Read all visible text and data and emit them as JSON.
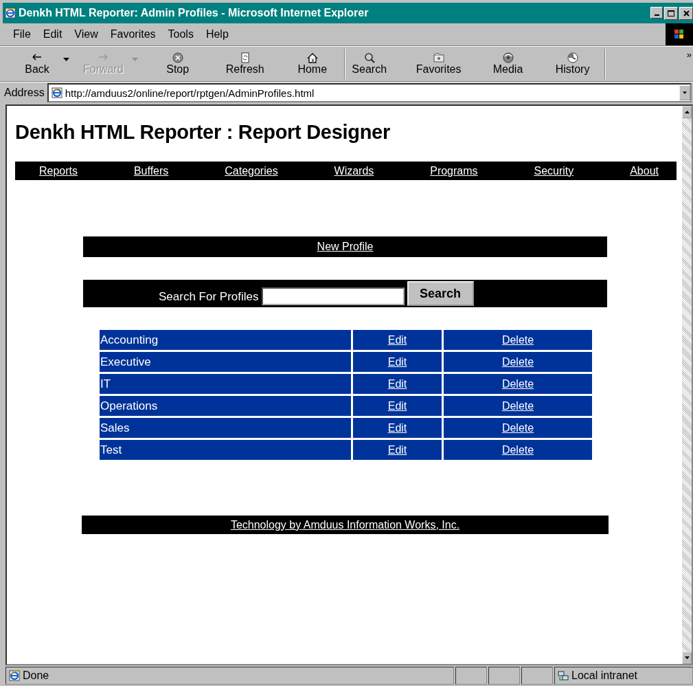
{
  "window": {
    "title": "Denkh HTML Reporter: Admin Profiles - Microsoft Internet Explorer"
  },
  "menu": [
    "File",
    "Edit",
    "View",
    "Favorites",
    "Tools",
    "Help"
  ],
  "toolbar": [
    {
      "kind": "back",
      "label": "Back",
      "disabled": false,
      "dropdown": true,
      "separator_after": false
    },
    {
      "kind": "forward",
      "label": "Forward",
      "disabled": true,
      "dropdown": true,
      "separator_after": false
    },
    {
      "kind": "stop",
      "label": "Stop",
      "disabled": false,
      "dropdown": false,
      "separator_after": false
    },
    {
      "kind": "refresh",
      "label": "Refresh",
      "disabled": false,
      "dropdown": false,
      "separator_after": false
    },
    {
      "kind": "home",
      "label": "Home",
      "disabled": false,
      "dropdown": false,
      "separator_after": true
    },
    {
      "kind": "search",
      "label": "Search",
      "disabled": false,
      "dropdown": false,
      "separator_after": false
    },
    {
      "kind": "favorites",
      "label": "Favorites",
      "disabled": false,
      "dropdown": false,
      "separator_after": false
    },
    {
      "kind": "media",
      "label": "Media",
      "disabled": false,
      "dropdown": false,
      "separator_after": false
    },
    {
      "kind": "history",
      "label": "History",
      "disabled": false,
      "dropdown": false,
      "separator_after": true
    }
  ],
  "toolbar_more": "»",
  "address": {
    "label": "Address",
    "url": "http://amduus2/online/report/rptgen/AdminProfiles.html"
  },
  "page": {
    "heading": "Denkh HTML Reporter : Report Designer",
    "nav": [
      "Reports",
      "Buffers",
      "Categories",
      "Wizards",
      "Programs",
      "Security",
      "About"
    ],
    "new_profile": "New Profile",
    "search": {
      "label": "Search For Profiles",
      "button": "Search"
    },
    "profiles": [
      {
        "name": "Accounting",
        "edit": "Edit",
        "delete": "Delete"
      },
      {
        "name": "Executive",
        "edit": "Edit",
        "delete": "Delete"
      },
      {
        "name": "IT",
        "edit": "Edit",
        "delete": "Delete"
      },
      {
        "name": "Operations",
        "edit": "Edit",
        "delete": "Delete"
      },
      {
        "name": "Sales",
        "edit": "Edit",
        "delete": "Delete"
      },
      {
        "name": "Test",
        "edit": "Edit",
        "delete": "Delete"
      }
    ],
    "footer": "Technology by Amduus Information Works, Inc."
  },
  "status_bar": {
    "text": "Done",
    "zone": "Local intranet"
  }
}
